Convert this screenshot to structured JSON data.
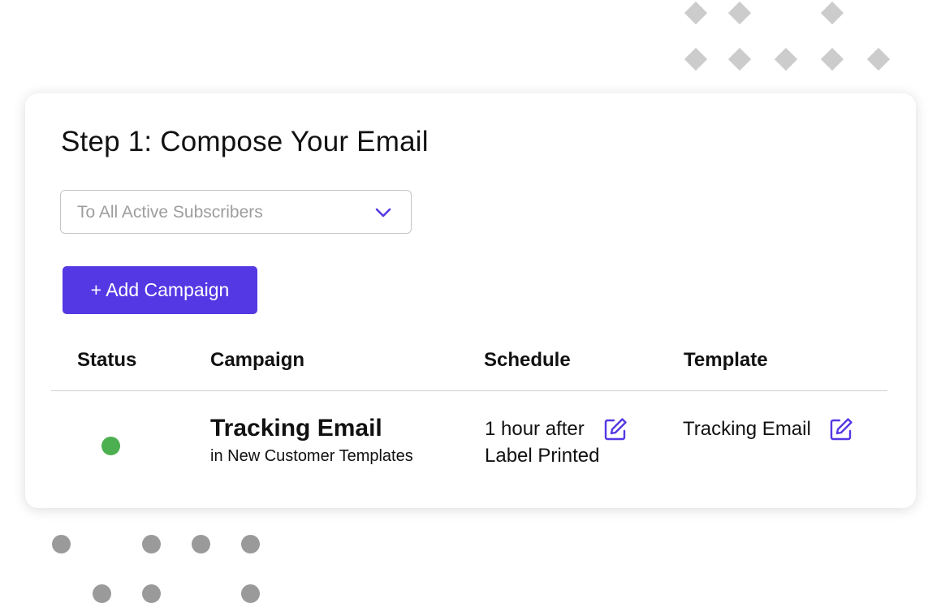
{
  "card": {
    "title": "Step 1: Compose Your Email",
    "audience_select": {
      "selected": "To All Active Subscribers",
      "icon": "chevron-down-icon"
    },
    "add_button_label": "+ Add Campaign"
  },
  "table": {
    "headers": {
      "status": "Status",
      "campaign": "Campaign",
      "schedule": "Schedule",
      "template": "Template"
    },
    "rows": [
      {
        "status": "active",
        "campaign_name": "Tracking Email",
        "campaign_location": "in New Customer Templates",
        "schedule_line1": "1 hour after",
        "schedule_line2": "Label Printed",
        "template": "Tracking Email"
      }
    ]
  },
  "colors": {
    "accent": "#5438e4",
    "status_active": "#4caf50",
    "decoration_diamond": "#cccccc",
    "decoration_dot": "#9a9a9a"
  }
}
